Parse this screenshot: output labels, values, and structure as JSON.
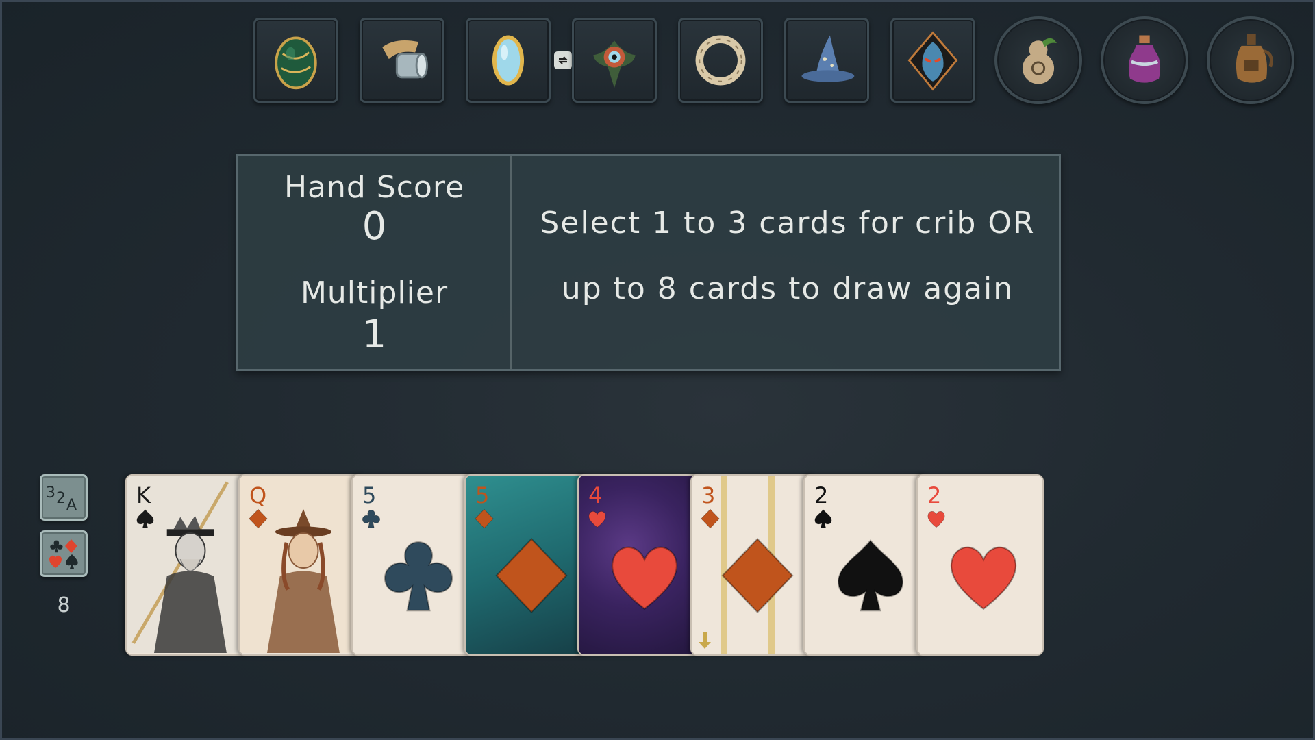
{
  "inventory": {
    "items": [
      {
        "name": "green egg"
      },
      {
        "name": "horn"
      },
      {
        "name": "mirror"
      },
      {
        "name": "eye amulet"
      },
      {
        "name": "ring"
      },
      {
        "name": "wizard hat"
      },
      {
        "name": "mask"
      },
      {
        "name": "gourd potion"
      },
      {
        "name": "purple potion"
      },
      {
        "name": "jug"
      }
    ]
  },
  "panel": {
    "hand_score_label": "Hand Score",
    "hand_score_value": "0",
    "multiplier_label": "Multiplier",
    "multiplier_value": "1",
    "instruction_line1": "Select 1 to 3 cards for crib OR",
    "instruction_line2": "up to 8 cards to draw again"
  },
  "side": {
    "sort_rank_label": "32A",
    "deck_count": "8"
  },
  "hand": [
    {
      "rank": "K",
      "suit": "spade",
      "style": "face",
      "color": "#1a1a1a"
    },
    {
      "rank": "Q",
      "suit": "diamond",
      "style": "face",
      "color": "#c0541c"
    },
    {
      "rank": "5",
      "suit": "club",
      "style": "plain",
      "color": "#2f4a5c"
    },
    {
      "rank": "5",
      "suit": "diamond",
      "style": "teal",
      "color": "#c0541c"
    },
    {
      "rank": "4",
      "suit": "heart",
      "style": "purple",
      "color": "#e84a3c"
    },
    {
      "rank": "3",
      "suit": "diamond",
      "style": "striped",
      "color": "#c0541c"
    },
    {
      "rank": "2",
      "suit": "spade",
      "style": "plain",
      "color": "#111111"
    },
    {
      "rank": "2",
      "suit": "heart",
      "style": "plain",
      "color": "#e84a3c"
    }
  ],
  "colors": {
    "diamond": "#c0541c",
    "heart": "#e84a3c",
    "club": "#2f4a5c",
    "spade": "#111111",
    "panel_bg": "#2e3d42"
  }
}
